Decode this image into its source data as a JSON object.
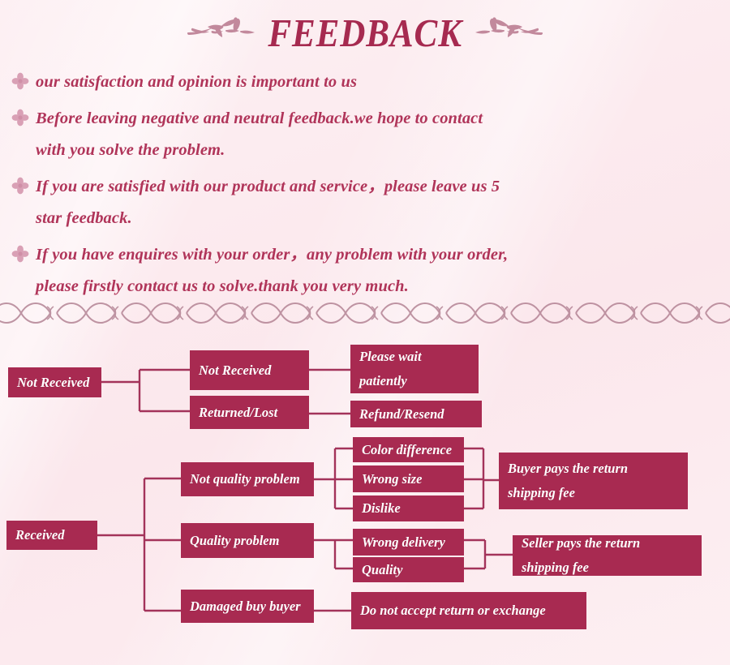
{
  "header": {
    "title": "FEEDBACK",
    "ornament_left": "leaf-branch-ornament",
    "ornament_right": "leaf-branch-ornament"
  },
  "colors": {
    "background": "#fdeef1",
    "accent": "#a62a50",
    "box_fill": "#a82a51",
    "box_text": "#ffffff",
    "body_text": "#b03459",
    "bullet": "#d9a0b5",
    "connector": "#a3335a"
  },
  "policy": {
    "bullet_icon": "flower-bullet-icon",
    "items": [
      {
        "lines": [
          "our satisfaction and opinion is important to us"
        ]
      },
      {
        "lines": [
          "Before leaving negative and neutral feedback.we hope to contact",
          "with you solve the problem."
        ]
      },
      {
        "lines": [
          "If you are satisfied with our product and service，please leave us 5",
          "star feedback."
        ]
      },
      {
        "lines": [
          "If you have enquires with your order，any problem with your order,",
          "please firstly contact us to solve.thank you very much."
        ]
      }
    ]
  },
  "divider": {
    "icon": "wave-braid-divider"
  },
  "flowchart": {
    "boxes": {
      "not_received_root": "Not Received",
      "not_received_child": "Not Received",
      "returned_lost": "Returned/Lost",
      "please_wait": "Please wait patiently",
      "please_wait_line1": "Please wait",
      "please_wait_line2": "patiently",
      "refund_resend": "Refund/Resend",
      "received_root": "Received",
      "not_quality_problem": "Not quality problem",
      "color_difference": "Color difference",
      "wrong_size": "Wrong size",
      "dislike": "Dislike",
      "buyer_pays_line1": "Buyer pays the return",
      "buyer_pays_line2": "shipping fee",
      "quality_problem": "Quality problem",
      "wrong_delivery": "Wrong delivery",
      "quality": "Quality",
      "seller_pays_line1": "Seller pays the return",
      "seller_pays_line2": "shipping fee",
      "damaged_by_buyer": "Damaged buy buyer",
      "no_return_exchange": "Do not accept return or exchange"
    }
  }
}
